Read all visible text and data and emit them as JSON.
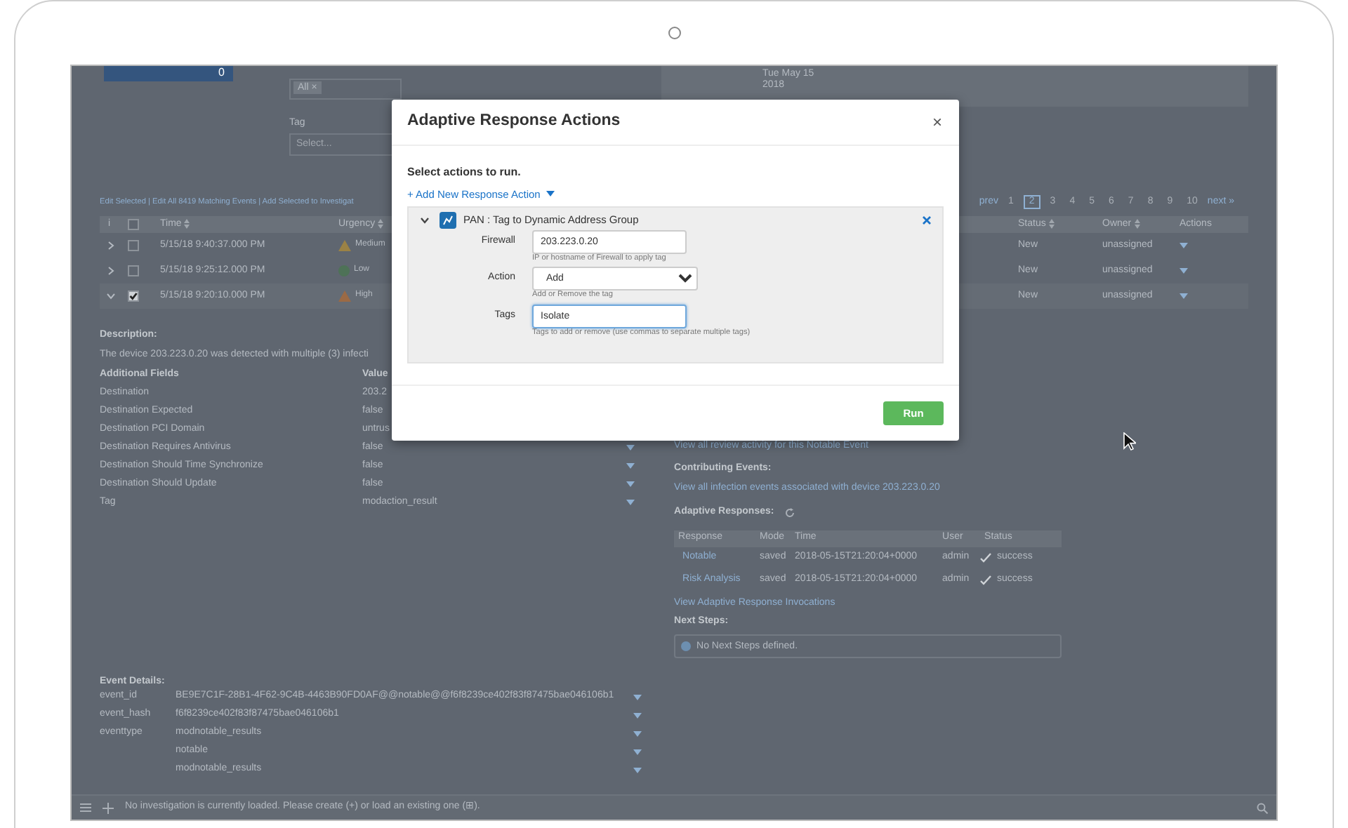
{
  "app": {
    "top_panel": {
      "count": "0"
    },
    "filters": {
      "chip": "All",
      "chip_remove": "×",
      "tag_label": "Tag",
      "tag_placeholder": "Select...",
      "date": [
        "Tue May 15",
        "2018"
      ]
    },
    "bulk_actions": "Edit Selected | Edit All 8419 Matching Events | Add Selected to Investigat",
    "pagination": {
      "prev": "prev",
      "pages": [
        {
          "label": "1",
          "selected": false
        },
        {
          "label": "2",
          "selected": true
        },
        {
          "label": "3",
          "selected": false
        },
        {
          "label": "4",
          "selected": false
        },
        {
          "label": "5",
          "selected": false
        },
        {
          "label": "6",
          "selected": false
        },
        {
          "label": "7",
          "selected": false
        },
        {
          "label": "8",
          "selected": false
        },
        {
          "label": "9",
          "selected": false
        },
        {
          "label": "10",
          "selected": false
        }
      ],
      "next": "next »"
    },
    "events_table": {
      "all_checked": false,
      "columns": {
        "info": "i",
        "time": "Time",
        "urgency": "Urgency",
        "status": "Status",
        "owner": "Owner",
        "actions": "Actions"
      },
      "rows": [
        {
          "expanded": false,
          "checked": false,
          "time": "5/15/18 9:40:37.000 PM",
          "kind": "triangle",
          "color": "#9b8245",
          "urgency": "Medium",
          "status": "New",
          "owner": "unassigned"
        },
        {
          "expanded": false,
          "checked": false,
          "time": "5/15/18 9:25:12.000 PM",
          "kind": "circle",
          "color": "#4e7257",
          "urgency": "Low",
          "status": "New",
          "owner": "unassigned"
        },
        {
          "expanded": true,
          "checked": true,
          "time": "5/15/18 9:20:10.000 PM",
          "kind": "triangle",
          "color": "#9b6a45",
          "urgency": "High",
          "status": "New",
          "owner": "unassigned"
        }
      ]
    },
    "description": {
      "heading": "Description:",
      "text": "The device 203.223.0.20 was detected with multiple (3) infecti"
    },
    "additional_fields": {
      "headers": [
        "Additional Fields",
        "Value"
      ],
      "rows": [
        {
          "name": "Destination",
          "value": "203.2",
          "menu": false
        },
        {
          "name": "Destination Expected",
          "value": "false",
          "menu": false
        },
        {
          "name": "Destination PCI Domain",
          "value": "untrus",
          "menu": false
        },
        {
          "name": "Destination Requires Antivirus",
          "value": "false",
          "menu": true
        },
        {
          "name": "Destination Should Time Synchronize",
          "value": "false",
          "menu": true
        },
        {
          "name": "Destination Should Update",
          "value": "false",
          "menu": true
        },
        {
          "name": "Tag",
          "value": "modaction_result",
          "menu": true
        }
      ]
    },
    "event_details": {
      "heading": "Event Details:",
      "rows": [
        {
          "field": "event_id",
          "value": "BE9E7C1F-28B1-4F62-9C4B-4463B90FD0AF@@notable@@f6f8239ce402f83f87475bae046106b1"
        },
        {
          "field": "event_hash",
          "value": "f6f8239ce402f83f87475bae046106b1"
        },
        {
          "field": "eventtype",
          "value": "modnotable_results"
        },
        {
          "value": "notable"
        },
        {
          "value": "modnotable_results"
        }
      ]
    },
    "review_link": "View all review activity for this Notable Event",
    "contributing": {
      "heading": "Contributing Events:",
      "link": "View all infection events associated with device 203.223.0.20"
    },
    "adaptive_responses": {
      "heading": "Adaptive Responses:",
      "columns": [
        "Response",
        "Mode",
        "Time",
        "User",
        "Status"
      ],
      "rows": [
        {
          "response": "Notable",
          "mode": "saved",
          "time": "2018-05-15T21:20:04+0000",
          "user": "admin",
          "status": "success"
        },
        {
          "response": "Risk Analysis",
          "mode": "saved",
          "time": "2018-05-15T21:20:04+0000",
          "user": "admin",
          "status": "success"
        }
      ],
      "invocations_link": "View Adaptive Response Invocations"
    },
    "next_steps": {
      "heading": "Next Steps:",
      "notice": "No Next Steps defined."
    },
    "investigation_bar": "No investigation is currently loaded. Please create (+) or load an existing one (⊞)."
  },
  "modal": {
    "title": "Adaptive Response Actions",
    "close": "×",
    "subtitle": "Select actions to run.",
    "add_action": "+ Add New Response Action",
    "action": {
      "expanded": true,
      "title": "PAN : Tag to Dynamic Address Group",
      "fields": [
        {
          "kind": "text",
          "label": "Firewall",
          "value": "203.223.0.20",
          "focused": false,
          "help": "IP or hostname of Firewall to apply tag"
        },
        {
          "kind": "select",
          "label": "Action",
          "value": "Add",
          "focused": false,
          "help": "Add or Remove the tag"
        },
        {
          "kind": "text",
          "label": "Tags",
          "value": "Isolate",
          "focused": true,
          "help": "Tags to add or remove (use commas to separate multiple tags)"
        }
      ]
    },
    "run": "Run"
  }
}
